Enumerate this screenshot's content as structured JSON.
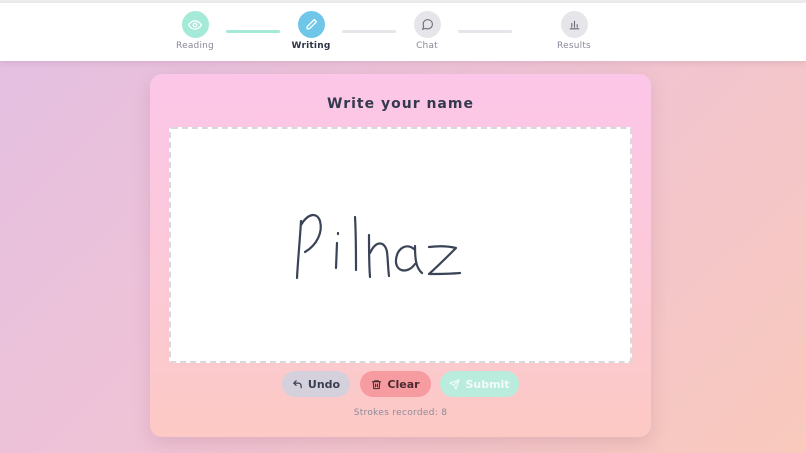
{
  "steps": [
    {
      "label": "Reading",
      "icon": "eye-icon",
      "state": "done",
      "color": "#a5ead8"
    },
    {
      "label": "Writing",
      "icon": "pencil-icon",
      "state": "active",
      "color": "#6fc6e8"
    },
    {
      "label": "Chat",
      "icon": "chat-bubble-icon",
      "state": "pending",
      "color": "#e5e5ea"
    },
    {
      "label": "Results",
      "icon": "bar-chart-icon",
      "state": "pending",
      "color": "#e5e5ea"
    }
  ],
  "card": {
    "title": "Write your name",
    "handwriting_text": "Pilnaz"
  },
  "buttons": {
    "undo": "Undo",
    "clear": "Clear",
    "submit": "Submit"
  },
  "status": {
    "strokes_label": "Strokes recorded: 8",
    "strokes_count": 8
  },
  "colors": {
    "accent_done": "#a5ead8",
    "accent_active": "#6fc6e8",
    "clear_button": "#f69b9f",
    "submit_button_disabled": "#b9ecdc",
    "undo_button": "#d4d0dc"
  }
}
